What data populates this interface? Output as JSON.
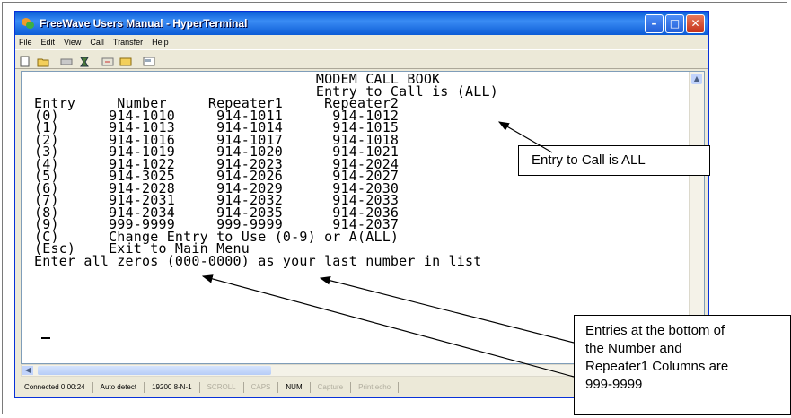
{
  "window": {
    "title": "FreeWave Users Manual - HyperTerminal",
    "menu": [
      "File",
      "Edit",
      "View",
      "Call",
      "Transfer",
      "Help"
    ],
    "toolbar_icons": [
      "new-icon",
      "open-icon",
      "disconnect-icon",
      "properties-icon",
      "send-icon",
      "receive-icon",
      "settings-icon"
    ]
  },
  "terminal": {
    "lines": [
      "                                  MODEM CALL BOOK",
      "                                  Entry to Call is (ALL)",
      "Entry     Number     Repeater1     Repeater2",
      "(0)      914-1010     914-1011      914-1012",
      "(1)      914-1013     914-1014      914-1015",
      "(2)      914-1016     914-1017      914-1018",
      "(3)      914-1019     914-1020      914-1021",
      "(4)      914-1022     914-2023      914-2024",
      "(5)      914-3025     914-2026      914-2027",
      "(6)      914-2028     914-2029      914-2030",
      "(7)      914-2031     914-2032      914-2033",
      "(8)      914-2034     914-2035      914-2036",
      "(9)      999-9999     999-9999      914-2037",
      "(C)      Change Entry to Use (0-9) or A(ALL)",
      "(Esc)    Exit to Main Menu",
      "Enter all zeros (000-0000) as your last number in list"
    ]
  },
  "statusbar": {
    "connected": "Connected 0:00:24",
    "detect": "Auto detect",
    "settings": "19200 8-N-1",
    "scroll": "SCROLL",
    "caps": "CAPS",
    "num": "NUM",
    "capture": "Capture",
    "print": "Print echo"
  },
  "callouts": {
    "entry_call": "Entry to Call is ALL",
    "bottom_entries": "Entries at the bottom of\nthe Number and\nRepeater1 Columns are\n999-9999"
  },
  "colors": {
    "titlebar": "#0b5bd6",
    "window_bg": "#ece9d8",
    "close_btn": "#c5321b"
  }
}
